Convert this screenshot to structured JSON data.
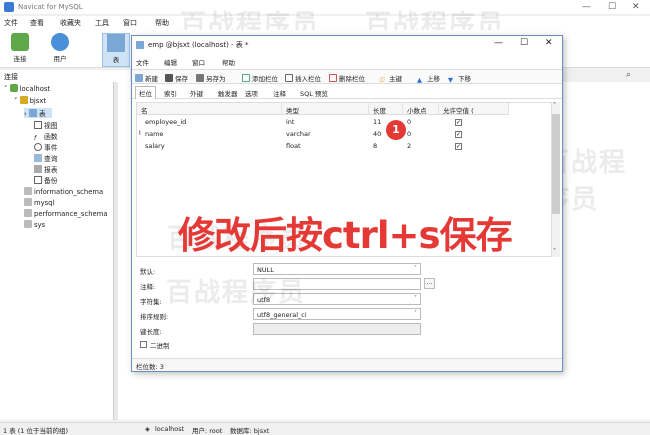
{
  "app": {
    "title": "Navicat for MySQL"
  },
  "menu": [
    "文件",
    "查看",
    "收藏夹",
    "工具",
    "窗口",
    "帮助"
  ],
  "toolbar": {
    "connect": "连接",
    "user": "用户",
    "table": "表"
  },
  "sidebar": {
    "header": "连接",
    "tree": [
      {
        "label": "localhost",
        "level": 0
      },
      {
        "label": "bjsxt",
        "level": 1
      },
      {
        "label": "表",
        "level": 2
      },
      {
        "label": "视图",
        "level": 3
      },
      {
        "label": "函数",
        "level": 3
      },
      {
        "label": "事件",
        "level": 3
      },
      {
        "label": "查询",
        "level": 3
      },
      {
        "label": "报表",
        "level": 3
      },
      {
        "label": "备份",
        "level": 3
      },
      {
        "label": "information_schema",
        "level": 1
      },
      {
        "label": "mysql",
        "level": 1
      },
      {
        "label": "performance_schema",
        "level": 1
      },
      {
        "label": "sys",
        "level": 1
      }
    ]
  },
  "statusbar": {
    "left": "1 表 (1 位于当前的组)",
    "host": "localhost",
    "user": "用户: root",
    "db": "数据库: bjsxt"
  },
  "watermark": "百战程序员",
  "dialog": {
    "title": "emp @bjsxt (localhost) - 表 *",
    "menu": [
      "文件",
      "编辑",
      "窗口",
      "帮助"
    ],
    "tools": [
      "新建",
      "保存",
      "另存为",
      "添加栏位",
      "插入栏位",
      "删除栏位",
      "主键",
      "上移",
      "下移"
    ],
    "tabs": [
      "栏位",
      "索引",
      "外键",
      "触发器",
      "选项",
      "注释",
      "SQL 预览"
    ],
    "columns": [
      "名",
      "类型",
      "长度",
      "小数点",
      "允许空值 ("
    ],
    "rows": [
      {
        "name": "employee_id",
        "type": "int",
        "length": "11",
        "decimals": "0",
        "nullable": true
      },
      {
        "name": "name",
        "type": "varchar",
        "length": "40",
        "decimals": "0",
        "nullable": true
      },
      {
        "name": "salary",
        "type": "float",
        "length": "8",
        "decimals": "2",
        "nullable": true
      }
    ],
    "props": {
      "default_label": "默认:",
      "default_value": "NULL",
      "comment_label": "注释:",
      "comment_btn": "...",
      "charset_label": "字符集:",
      "charset_value": "utf8",
      "collation_label": "排序规则:",
      "collation_value": "utf8_general_ci",
      "keylen_label": "键长度:",
      "binary_label": "二进制"
    },
    "status": "栏位数: 3"
  },
  "annotation": {
    "text": "修改后按ctrl+s保存",
    "marker": "1"
  },
  "colors": {
    "accent": "#e53935",
    "selected": "#cfe3f7"
  }
}
